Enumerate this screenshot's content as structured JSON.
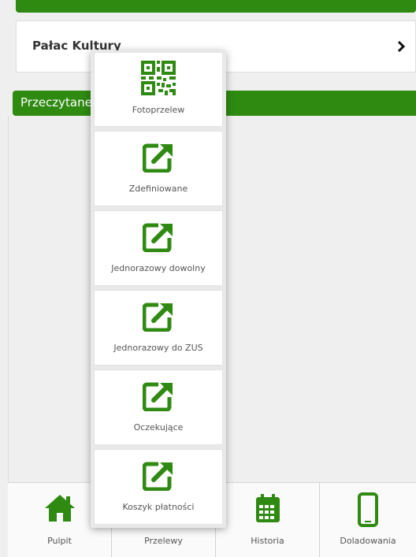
{
  "recipient": {
    "name": "Pałac Kultury"
  },
  "section": {
    "title": "Przeczytane"
  },
  "menu": {
    "items": [
      {
        "label": "Fotoprzelew",
        "icon": "qr-code-icon"
      },
      {
        "label": "Zdefiniowane",
        "icon": "external-link-icon"
      },
      {
        "label": "Jednorazowy dowolny",
        "icon": "external-link-icon"
      },
      {
        "label": "Jednorazowy do ZUS",
        "icon": "external-link-icon"
      },
      {
        "label": "Oczekujące",
        "icon": "external-link-icon"
      },
      {
        "label": "Koszyk płatności",
        "icon": "external-link-icon"
      }
    ]
  },
  "bottom_nav": {
    "items": [
      {
        "label": "Pulpit",
        "icon": "home-icon"
      },
      {
        "label": "Przelewy",
        "icon": "transfer-icon"
      },
      {
        "label": "Historia",
        "icon": "calendar-icon"
      },
      {
        "label": "Doladowania",
        "icon": "phone-icon"
      }
    ]
  },
  "colors": {
    "brand_green": "#2f8a12"
  }
}
